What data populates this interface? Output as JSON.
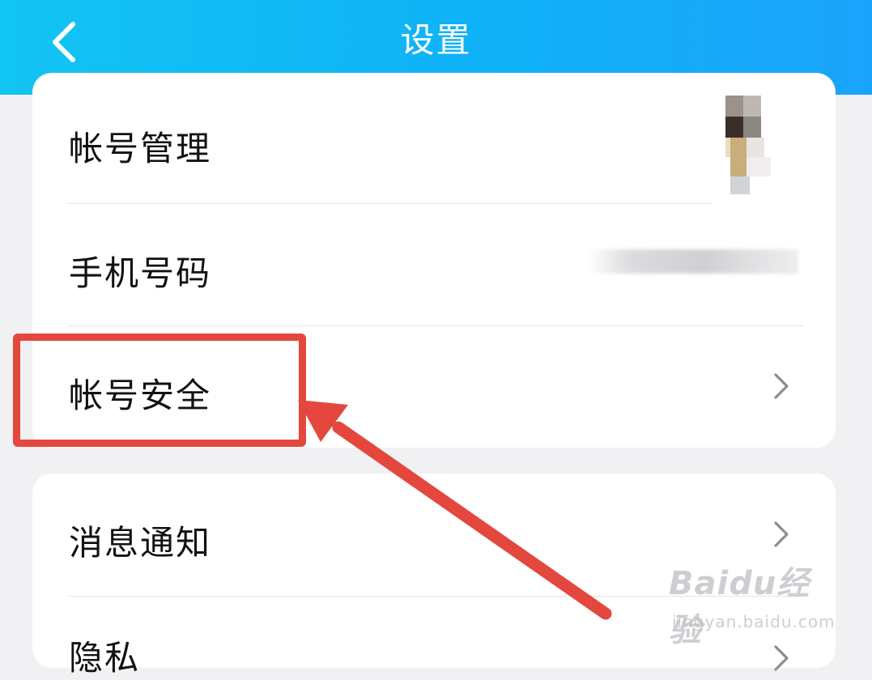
{
  "header": {
    "title": "设置",
    "back_icon": "chevron-left-icon",
    "background_gradient": [
      "#12c4f2",
      "#1aa3fb"
    ]
  },
  "settings": {
    "group1": [
      {
        "label": "帐号管理",
        "trailing": "avatar"
      },
      {
        "label": "手机号码",
        "trailing": "masked-value"
      },
      {
        "label": "帐号安全",
        "trailing": "chevron-right-icon"
      }
    ],
    "group2": [
      {
        "label": "消息通知",
        "trailing": "chevron-right-icon"
      },
      {
        "label": "隐私",
        "trailing": "chevron-right-icon"
      }
    ]
  },
  "annotation": {
    "highlight_color": "#e4473d",
    "highlighted_item": "帐号安全"
  },
  "watermark": {
    "brand": "Baidu经验",
    "url": "jingyan.baidu.com"
  }
}
